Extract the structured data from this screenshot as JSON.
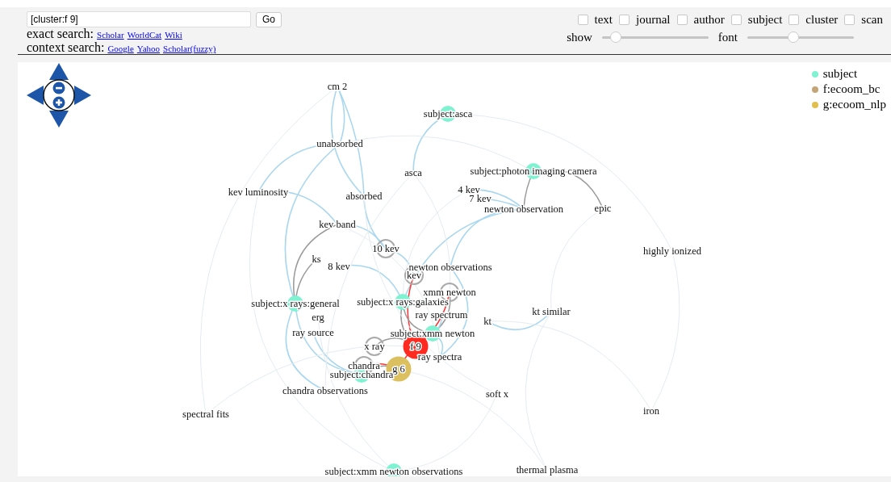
{
  "search": {
    "value": "[cluster:f 9]",
    "button": "Go"
  },
  "exact_search": {
    "label": "exact search:",
    "links": [
      "Scholar",
      "WorldCat",
      "Wiki"
    ]
  },
  "context_search": {
    "label": "context search:",
    "links": [
      "Google",
      "Yahoo",
      "Scholar(fuzzy)"
    ]
  },
  "filters": [
    {
      "label": "text",
      "checked": false
    },
    {
      "label": "journal",
      "checked": false
    },
    {
      "label": "author",
      "checked": false
    },
    {
      "label": "subject",
      "checked": false
    },
    {
      "label": "cluster",
      "checked": false
    },
    {
      "label": "scan",
      "checked": false
    }
  ],
  "sliders": [
    {
      "label": "show",
      "level": 0.13
    },
    {
      "label": "font",
      "level": 0.43
    }
  ],
  "legend": [
    {
      "label": "subject",
      "color": "#7ff2d2"
    },
    {
      "label": "f:ecoom_bc",
      "color": "#c4a578"
    },
    {
      "label": "g:ecoom_nlp",
      "color": "#e0bf4c"
    }
  ],
  "nodes": [
    {
      "label": "cm 2",
      "kind": "term"
    },
    {
      "label": "subject:asca",
      "kind": "subject",
      "color": "#7ff2d2"
    },
    {
      "label": "unabsorbed",
      "kind": "term"
    },
    {
      "label": "asca",
      "kind": "term"
    },
    {
      "label": "subject:photon imaging camera",
      "kind": "subject",
      "color": "#7ff2d2"
    },
    {
      "label": "kev luminosity",
      "kind": "term"
    },
    {
      "label": "absorbed",
      "kind": "term"
    },
    {
      "label": "4 kev",
      "kind": "term"
    },
    {
      "label": "7 kev",
      "kind": "term"
    },
    {
      "label": "newton observation",
      "kind": "term"
    },
    {
      "label": "epic",
      "kind": "term"
    },
    {
      "label": "kev band",
      "kind": "term"
    },
    {
      "label": "highly ionized",
      "kind": "term"
    },
    {
      "label": "10 kev",
      "kind": "ringed"
    },
    {
      "label": "ks",
      "kind": "term"
    },
    {
      "label": "8 kev",
      "kind": "term"
    },
    {
      "label": "newton observations",
      "kind": "term"
    },
    {
      "label": "kev",
      "kind": "ringed"
    },
    {
      "label": "xmm newton",
      "kind": "ringed"
    },
    {
      "label": "subject:x rays:general",
      "kind": "subject",
      "color": "#7ff2d2"
    },
    {
      "label": "subject:x rays:galaxies",
      "kind": "subject",
      "color": "#7ff2d2"
    },
    {
      "label": "kt similar",
      "kind": "term"
    },
    {
      "label": "erg",
      "kind": "term"
    },
    {
      "label": "ray spectrum",
      "kind": "term"
    },
    {
      "label": "kt",
      "kind": "term"
    },
    {
      "label": "ray source",
      "kind": "term"
    },
    {
      "label": "subject:xmm newton",
      "kind": "subject",
      "color": "#7ff2d2"
    },
    {
      "label": "x ray",
      "kind": "ringed"
    },
    {
      "label": "f 9",
      "kind": "cluster",
      "color": "#ff2b20"
    },
    {
      "label": "ray spectra",
      "kind": "term"
    },
    {
      "label": "chandra",
      "kind": "ringed"
    },
    {
      "label": "g 6",
      "kind": "cluster",
      "color": "#dcbf5e"
    },
    {
      "label": "subject:chandra",
      "kind": "subject",
      "color": "#7ff2d2"
    },
    {
      "label": "chandra observations",
      "kind": "term"
    },
    {
      "label": "soft x",
      "kind": "term"
    },
    {
      "label": "spectral fits",
      "kind": "term"
    },
    {
      "label": "iron",
      "kind": "term"
    },
    {
      "label": "subject:xmm newton observations",
      "kind": "subject",
      "color": "#7ff2d2"
    },
    {
      "label": "thermal plasma",
      "kind": "term"
    }
  ]
}
